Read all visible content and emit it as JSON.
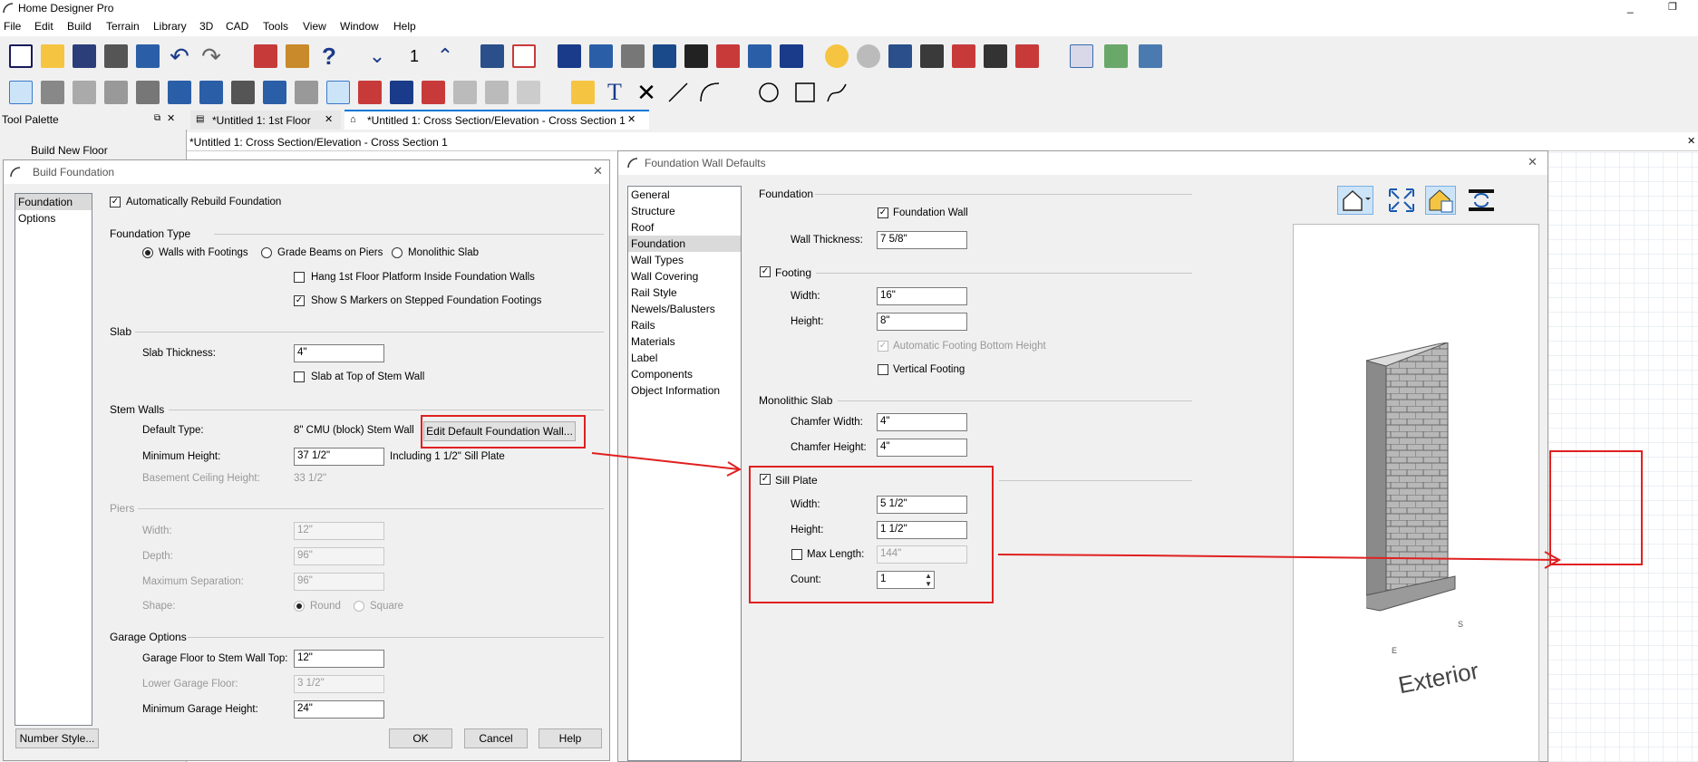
{
  "app": {
    "title": "Home Designer Pro"
  },
  "menu": [
    "File",
    "Edit",
    "Build",
    "Terrain",
    "Library",
    "3D",
    "CAD",
    "Tools",
    "View",
    "Window",
    "Help"
  ],
  "toolbar": {
    "floor_number": "1"
  },
  "palette": {
    "title": "Tool Palette",
    "item": "Build New Floor"
  },
  "tabs": [
    {
      "label": "*Untitled 1: 1st Floor"
    },
    {
      "label": "*Untitled 1: Cross Section/Elevation - Cross Section 1"
    }
  ],
  "view_title": "*Untitled 1: Cross Section/Elevation - Cross Section 1",
  "build_foundation": {
    "title": "Build Foundation",
    "nav": [
      "Foundation",
      "Options"
    ],
    "auto_rebuild": "Automatically Rebuild Foundation",
    "foundation_type": {
      "heading": "Foundation Type",
      "walls": "Walls with Footings",
      "beams": "Grade Beams on Piers",
      "mono": "Monolithic Slab",
      "hang": "Hang 1st Floor Platform Inside Foundation Walls",
      "markers": "Show S Markers on Stepped Foundation Footings"
    },
    "slab": {
      "heading": "Slab",
      "thickness_label": "Slab Thickness:",
      "thickness": "4\"",
      "top_label": "Slab at Top of Stem Wall"
    },
    "stem": {
      "heading": "Stem Walls",
      "default_label": "Default Type:",
      "default_value": "8\" CMU (block) Stem Wall",
      "edit_button": "Edit Default Foundation Wall...",
      "min_label": "Minimum Height:",
      "min_value": "37 1/2\"",
      "including": "Including 1 1/2\" Sill Plate",
      "basement_label": "Basement Ceiling Height:",
      "basement_value": "33 1/2\""
    },
    "piers": {
      "heading": "Piers",
      "width_label": "Width:",
      "width": "12\"",
      "depth_label": "Depth:",
      "depth": "96\"",
      "sep_label": "Maximum Separation:",
      "sep": "96\"",
      "shape_label": "Shape:",
      "round": "Round",
      "square": "Square"
    },
    "garage": {
      "heading": "Garage Options",
      "floor_label": "Garage Floor to Stem Wall Top:",
      "floor": "12\"",
      "lower_label": "Lower Garage Floor:",
      "lower": "3 1/2\"",
      "min_label": "Minimum Garage Height:",
      "min": "24\""
    },
    "buttons": {
      "number_style": "Number Style...",
      "ok": "OK",
      "cancel": "Cancel",
      "help": "Help"
    }
  },
  "wall_defaults": {
    "title": "Foundation Wall Defaults",
    "nav": [
      "General",
      "Structure",
      "Roof",
      "Foundation",
      "Wall Types",
      "Wall Covering",
      "Rail Style",
      "Newels/Balusters",
      "Rails",
      "Materials",
      "Label",
      "Components",
      "Object Information"
    ],
    "foundation": {
      "heading": "Foundation",
      "wall_label": "Foundation Wall",
      "thick_label": "Wall Thickness:",
      "thick": "7 5/8\""
    },
    "footing": {
      "heading": "Footing",
      "width_label": "Width:",
      "width": "16\"",
      "height_label": "Height:",
      "height": "8\"",
      "auto": "Automatic Footing Bottom Height",
      "vertical": "Vertical Footing"
    },
    "mono": {
      "heading": "Monolithic Slab",
      "cw_label": "Chamfer Width:",
      "cw": "4\"",
      "ch_label": "Chamfer Height:",
      "ch": "4\""
    },
    "sill": {
      "heading": "Sill Plate",
      "width_label": "Width:",
      "width": "5 1/2\"",
      "height_label": "Height:",
      "height": "1 1/2\"",
      "max_label": "Max Length:",
      "max": "144\"",
      "count_label": "Count:",
      "count": "1"
    },
    "preview": {
      "label": "Exterior",
      "e": "E",
      "s": "S"
    }
  },
  "colors": {
    "annotation": "#e02020",
    "accent": "#0078d7"
  }
}
